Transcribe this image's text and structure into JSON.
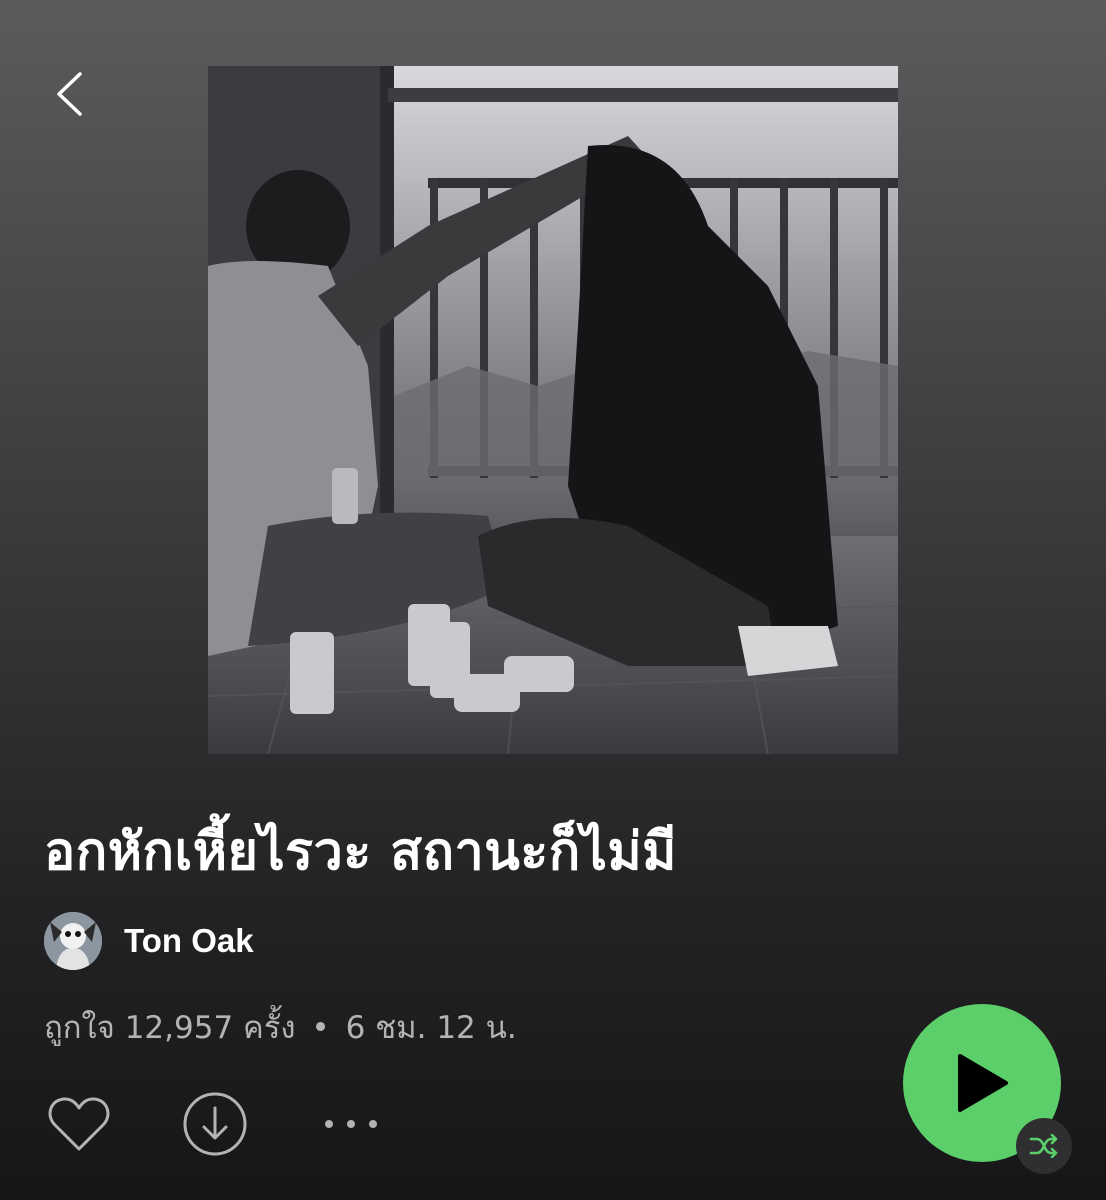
{
  "navigation": {
    "back_icon": "chevron-left-icon"
  },
  "playlist": {
    "cover_alt": "",
    "title": "อกหักเหี้ยไรวะ สถานะก็ไม่มี",
    "owner": {
      "name": "Ton Oak",
      "avatar_icon": "avatar-image"
    },
    "meta": {
      "likes": "ถูกใจ 12,957 ครั้ง",
      "separator": "•",
      "duration": "6 ชม. 12 น."
    }
  },
  "actions": {
    "like_icon": "heart-icon",
    "download_icon": "download-circle-icon",
    "more_icon": "more-dots-icon",
    "play_icon": "play-icon",
    "shuffle_icon": "shuffle-icon"
  },
  "colors": {
    "accent": "#5ccf6a",
    "shuffle_active": "#5ccf6a",
    "text_secondary": "#b3b3b3"
  }
}
